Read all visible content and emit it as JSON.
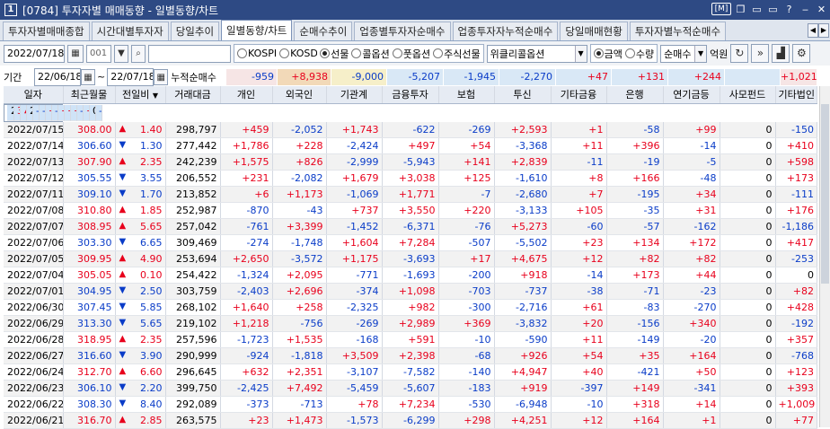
{
  "window": {
    "number": "1",
    "title": "[0784] 투자자별 매매동향 - 일별동향/차트"
  },
  "titlebar_controls": [
    "[?]",
    "□",
    "▭",
    "T",
    "?",
    "_",
    "x"
  ],
  "tabs": [
    "투자자별매매종합",
    "시간대별투자자",
    "당일추이",
    "일별동향/차트",
    "순매수추이",
    "업종별투자자순매수",
    "업종투자자누적순매수",
    "당일매매현황",
    "투자자별누적순매수"
  ],
  "active_tab": 3,
  "toolbar": {
    "date": "2022/07/18",
    "code": "001",
    "radios1": [
      {
        "label": "KOSPI",
        "on": false
      },
      {
        "label": "KOSDAQ",
        "on": false
      },
      {
        "label": "선물",
        "on": true
      },
      {
        "label": "콜옵션",
        "on": false
      },
      {
        "label": "풋옵션",
        "on": false
      },
      {
        "label": "주식선물",
        "on": false
      }
    ],
    "product_select": "위클리콜옵션",
    "radios2": [
      {
        "label": "금액",
        "on": true
      },
      {
        "label": "수량",
        "on": false
      }
    ],
    "mode_select": "순매수",
    "unit_label": "억원"
  },
  "period": {
    "label": "기간",
    "from": "22/06/18",
    "to": "22/07/18",
    "caption": "누적순매수"
  },
  "summary": [
    "-959",
    "+8,938",
    "-9,000",
    "-5,207",
    "-1,945",
    "-2,270",
    "+47",
    "+131",
    "+244",
    "",
    "+1,021"
  ],
  "columns": [
    "일자",
    "최근월물",
    "전일비",
    "거래대금",
    "개인",
    "외국인",
    "기관계",
    "금융투자",
    "보험",
    "투신",
    "기타금융",
    "은행",
    "연기금등",
    "사모펀드",
    "기타법인"
  ],
  "rows": [
    [
      "2022/07/18",
      "316.00",
      "up",
      "8.00",
      "215,587",
      "-2,355",
      "-1,211",
      "+3,607",
      "-171",
      "+9",
      "+3,714",
      "+148",
      "-303",
      "+209",
      "0",
      "-40"
    ],
    [
      "2022/07/15",
      "308.00",
      "up",
      "1.40",
      "298,797",
      "+459",
      "-2,052",
      "+1,743",
      "-622",
      "-269",
      "+2,593",
      "+1",
      "-58",
      "+99",
      "0",
      "-150"
    ],
    [
      "2022/07/14",
      "306.60",
      "dn",
      "1.30",
      "277,442",
      "+1,786",
      "+228",
      "-2,424",
      "+497",
      "+54",
      "-3,368",
      "+11",
      "+396",
      "-14",
      "0",
      "+410"
    ],
    [
      "2022/07/13",
      "307.90",
      "up",
      "2.35",
      "242,239",
      "+1,575",
      "+826",
      "-2,999",
      "-5,943",
      "+141",
      "+2,839",
      "-11",
      "-19",
      "-5",
      "0",
      "+598"
    ],
    [
      "2022/07/12",
      "305.55",
      "dn",
      "3.55",
      "206,552",
      "+231",
      "-2,082",
      "+1,679",
      "+3,038",
      "+125",
      "-1,610",
      "+8",
      "+166",
      "-48",
      "0",
      "+173"
    ],
    [
      "2022/07/11",
      "309.10",
      "dn",
      "1.70",
      "213,852",
      "+6",
      "+1,173",
      "-1,069",
      "+1,771",
      "-7",
      "-2,680",
      "+7",
      "-195",
      "+34",
      "0",
      "-111"
    ],
    [
      "2022/07/08",
      "310.80",
      "up",
      "1.85",
      "252,987",
      "-870",
      "-43",
      "+737",
      "+3,550",
      "+220",
      "-3,133",
      "+105",
      "-35",
      "+31",
      "0",
      "+176"
    ],
    [
      "2022/07/07",
      "308.95",
      "up",
      "5.65",
      "257,042",
      "-761",
      "+3,399",
      "-1,452",
      "-6,371",
      "-76",
      "+5,273",
      "-60",
      "-57",
      "-162",
      "0",
      "-1,186"
    ],
    [
      "2022/07/06",
      "303.30",
      "dn",
      "6.65",
      "309,469",
      "-274",
      "-1,748",
      "+1,604",
      "+7,284",
      "-507",
      "-5,502",
      "+23",
      "+134",
      "+172",
      "0",
      "+417"
    ],
    [
      "2022/07/05",
      "309.95",
      "up",
      "4.90",
      "253,694",
      "+2,650",
      "-3,572",
      "+1,175",
      "-3,693",
      "+17",
      "+4,675",
      "+12",
      "+82",
      "+82",
      "0",
      "-253"
    ],
    [
      "2022/07/04",
      "305.05",
      "up",
      "0.10",
      "254,422",
      "-1,324",
      "+2,095",
      "-771",
      "-1,693",
      "-200",
      "+918",
      "-14",
      "+173",
      "+44",
      "0",
      "0"
    ],
    [
      "2022/07/01",
      "304.95",
      "dn",
      "2.50",
      "303,759",
      "-2,403",
      "+2,696",
      "-374",
      "+1,098",
      "-703",
      "-737",
      "-38",
      "-71",
      "-23",
      "0",
      "+82"
    ],
    [
      "2022/06/30",
      "307.45",
      "dn",
      "5.85",
      "268,102",
      "+1,640",
      "+258",
      "-2,325",
      "+982",
      "-300",
      "-2,716",
      "+61",
      "-83",
      "-270",
      "0",
      "+428"
    ],
    [
      "2022/06/29",
      "313.30",
      "dn",
      "5.65",
      "219,102",
      "+1,218",
      "-756",
      "-269",
      "+2,989",
      "+369",
      "-3,832",
      "+20",
      "-156",
      "+340",
      "0",
      "-192"
    ],
    [
      "2022/06/28",
      "318.95",
      "up",
      "2.35",
      "257,596",
      "-1,723",
      "+1,535",
      "-168",
      "+591",
      "-10",
      "-590",
      "+11",
      "-149",
      "-20",
      "0",
      "+357"
    ],
    [
      "2022/06/27",
      "316.60",
      "dn",
      "3.90",
      "290,999",
      "-924",
      "-1,818",
      "+3,509",
      "+2,398",
      "-68",
      "+926",
      "+54",
      "+35",
      "+164",
      "0",
      "-768"
    ],
    [
      "2022/06/24",
      "312.70",
      "up",
      "6.60",
      "296,645",
      "+632",
      "+2,351",
      "-3,107",
      "-7,582",
      "-140",
      "+4,947",
      "+40",
      "-421",
      "+50",
      "0",
      "+123"
    ],
    [
      "2022/06/23",
      "306.10",
      "dn",
      "2.20",
      "399,750",
      "-2,425",
      "+7,492",
      "-5,459",
      "-5,607",
      "-183",
      "+919",
      "-397",
      "+149",
      "-341",
      "0",
      "+393"
    ],
    [
      "2022/06/22",
      "308.30",
      "dn",
      "8.40",
      "292,089",
      "-373",
      "-713",
      "+78",
      "+7,234",
      "-530",
      "-6,948",
      "-10",
      "+318",
      "+14",
      "0",
      "+1,009"
    ],
    [
      "2022/06/21",
      "316.70",
      "up",
      "2.85",
      "263,575",
      "+23",
      "+1,473",
      "-1,573",
      "-6,299",
      "+298",
      "+4,251",
      "+12",
      "+164",
      "+1",
      "0",
      "+77"
    ]
  ],
  "colors": {
    "titlebar": "#2e4a84",
    "up": "#e8001c",
    "down": "#0a3cc8",
    "selected_row": "#cfe3f7",
    "summary_bg": [
      "#f6e5e5",
      "#f2d9b8",
      "#f6efc9",
      "#d9e8f6"
    ]
  }
}
